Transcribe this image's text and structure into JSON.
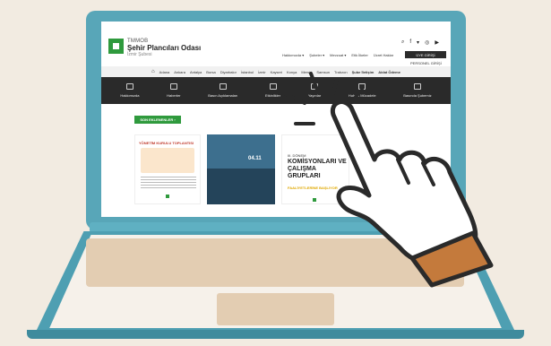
{
  "site": {
    "org_top": "TMMOB",
    "org_main": "Şehir Plancıları Odası",
    "org_sub": "İzmir Şubesi",
    "top_links": [
      "Hakkımızda ▾",
      "Şubeler ▾",
      "Mevzuat ▾",
      "Etik İlkeler",
      "Ücret Haklar"
    ],
    "login_label": "ÜYE GİRİŞİ",
    "personal_login": "PERSONEL GİRİŞİ",
    "menu": [
      "Adana",
      "Ankara",
      "Antalya",
      "Bursa",
      "Diyarbakır",
      "İstanbul",
      "İzmir",
      "Kayseri",
      "Konya",
      "Mersin",
      "Samsun",
      "Trabzon"
    ],
    "menu_strong": [
      "Şube İletişim",
      "Aidat Ödeme"
    ],
    "toolbar": [
      {
        "label": "Hakkımızda",
        "icon": "document-icon"
      },
      {
        "label": "Haberler",
        "icon": "news-icon"
      },
      {
        "label": "Basın Açıklamaları",
        "icon": "megaphone-icon"
      },
      {
        "label": "Etkinlikler",
        "icon": "people-icon"
      },
      {
        "label": "Yayınlar",
        "icon": "book-icon"
      },
      {
        "label": "Hukuki Mücadele",
        "icon": "scale-icon"
      },
      {
        "label": "Basında Şubemiz",
        "icon": "chat-icon"
      }
    ],
    "section_button": "SON EKLENENLER  ›",
    "card1_title": "YÖNETİM KURULU TOPLANTISI",
    "card2_date": "04.11",
    "card3_donem": "III. DÖNEM",
    "card3_big": "KOMİSYONLARI VE ÇALIŞMA GRUPLARI",
    "card3_yellow": "FAALİYETLERİNE BAŞLIYOR"
  },
  "colors": {
    "background": "#f2ebe1",
    "laptop": "#58a6b8",
    "accent_green": "#2f9a3d",
    "toolbar": "#2a2a2a",
    "hand_outline": "#2a2a2a",
    "cuff": "#c47a3c"
  }
}
